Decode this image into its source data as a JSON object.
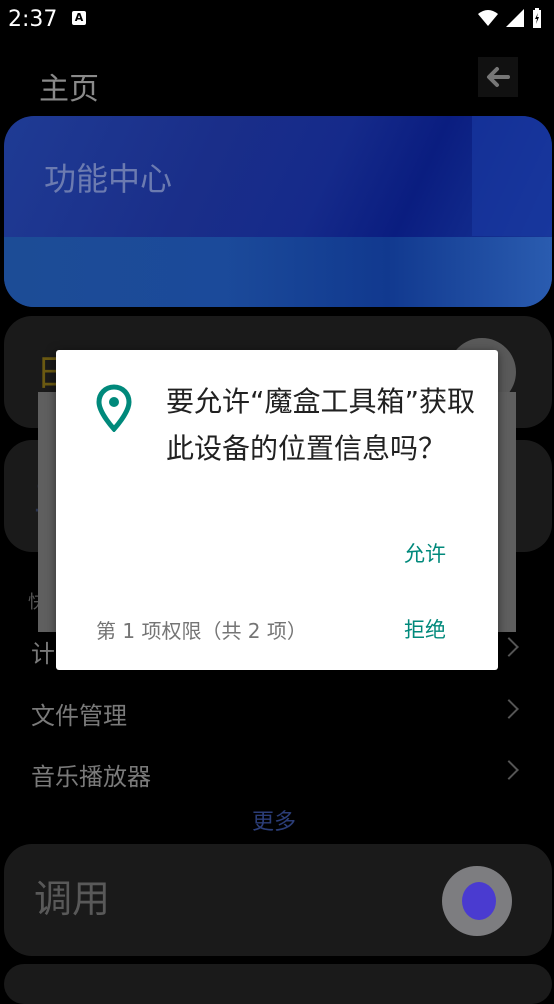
{
  "status_bar": {
    "time": "2:37",
    "notification_icon": "a-icon",
    "icons": [
      "wifi-icon",
      "signal-icon",
      "battery-icon"
    ]
  },
  "header": {
    "title": "主页",
    "back_icon": "arrow-left-icon"
  },
  "banner": {
    "title": "功能中心"
  },
  "cards": {
    "rizhi": "日志",
    "tools": "工具",
    "call": "调用"
  },
  "quick_section": {
    "label": "快",
    "items": [
      {
        "label": "计"
      },
      {
        "label": "文件管理"
      },
      {
        "label": "音乐播放器"
      }
    ],
    "more": "更多"
  },
  "dialog": {
    "icon": "location-pin-icon",
    "message": "要允许“魔盒工具箱”获取此设备的位置信息吗？",
    "allow_label": "允许",
    "counter": "第 1 项权限（共 2 项）",
    "deny_label": "拒绝",
    "accent": "#00897b"
  }
}
